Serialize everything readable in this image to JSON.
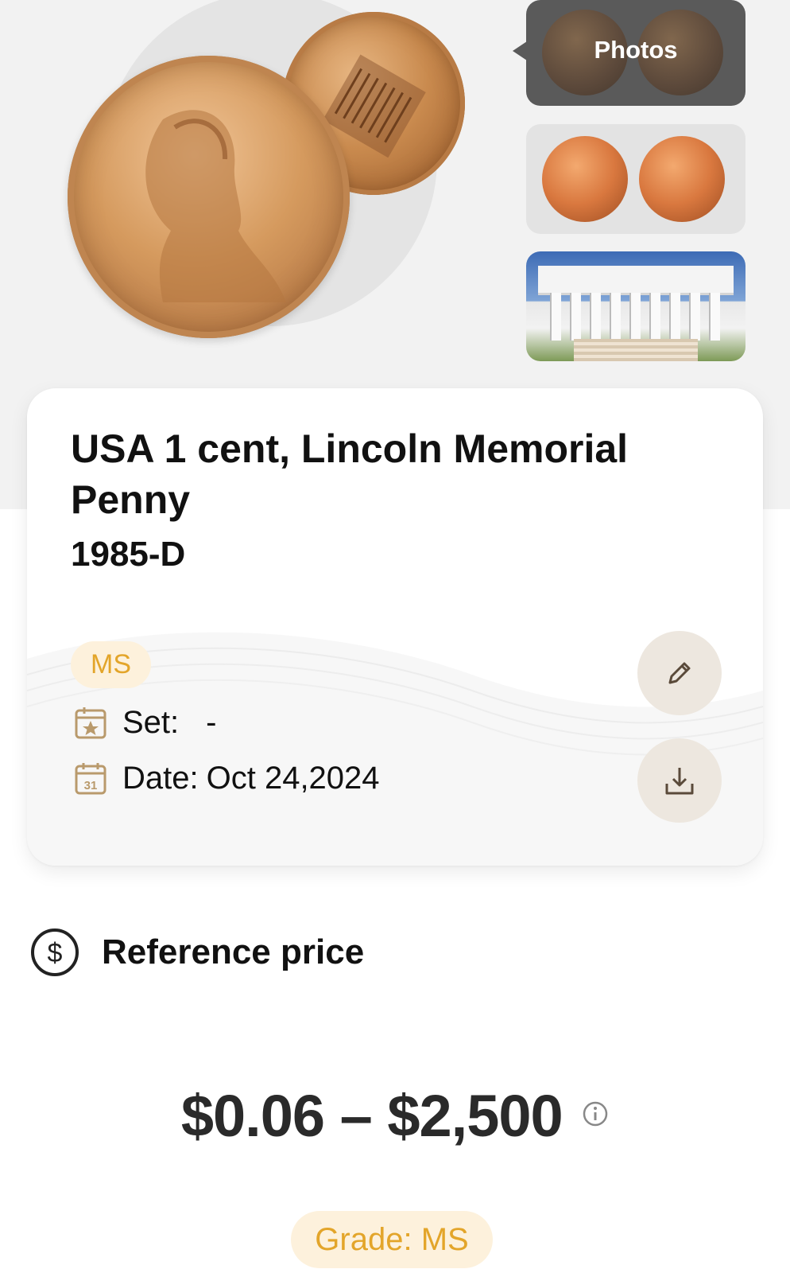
{
  "gallery": {
    "photos_label": "Photos"
  },
  "coin": {
    "title": "USA 1 cent, Lincoln Memorial Penny",
    "mint_year": "1985-D",
    "grade_badge": "MS",
    "set_label": "Set:",
    "set_value": "-",
    "date_label": "Date:",
    "date_value": "Oct 24,2024",
    "calendar_day": "31"
  },
  "reference_price": {
    "heading": "Reference price",
    "range": "$0.06 – $2,500",
    "grade_pill": "Grade: MS"
  },
  "colors": {
    "accent": "#e3a52a",
    "badge_bg": "#fdf1dc",
    "button_bg": "#ede7df"
  }
}
